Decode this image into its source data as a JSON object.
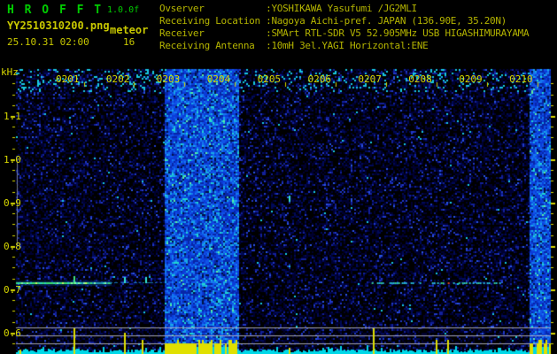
{
  "header": {
    "app_title": "H R O F F T",
    "version": "1.0.0f",
    "filename": "YY2510310200.png",
    "mode": "meteor",
    "datetime": "25.10.31 02:00",
    "meteor_count": "16",
    "info": [
      {
        "label": "Ovserver",
        "value": "YOSHIKAWA Yasufumi /JG2MLI"
      },
      {
        "label": "Receiving Location",
        "value": "Nagoya Aichi-pref. JAPAN (136.90E, 35.20N)"
      },
      {
        "label": "Receiver",
        "value": "SMArt RTL-SDR V5 52.905MHz USB HIGASHIMURAYAMA"
      },
      {
        "label": "Receiving Antenna",
        "value": "10mH 3el.YAGI Horizontal:ENE"
      }
    ]
  },
  "colors": {
    "title_green": "#00cc00",
    "label_yellow": "#c8c800",
    "info_yellow": "#b4b400",
    "tick_yellow": "#d8d800",
    "baseline_cyan": "#00d8e8",
    "bar_yellow": "#e0e000",
    "reference_gray": "#b0b0b8"
  },
  "chart_data": {
    "type": "heatmap",
    "subtype": "radio-meteor-spectrogram",
    "title": "HROFFT 10-minute meteor observation spectrogram 02:00-02:10",
    "x_axis": {
      "start_time": "02:00",
      "end_time": "02:10",
      "span_minutes": 10,
      "tick_labels": [
        "0201",
        "0202",
        "0203",
        "0204",
        "0205",
        "0206",
        "0207",
        "0208",
        "0209",
        "0210"
      ]
    },
    "y_axis": {
      "label": "kHz",
      "tick_labels": [
        "1.1",
        "1.0",
        "0.9",
        "0.8",
        "0.7",
        "0.6"
      ],
      "tick_values": [
        1.1,
        1.0,
        0.9,
        0.8,
        0.7,
        0.6
      ],
      "range_khz": [
        0.575,
        1.19
      ],
      "minor_step_khz": 0.025
    },
    "carrier_line_khz": 0.716,
    "meteor_count": 16,
    "interference_bands": [
      {
        "start_min": 2.75,
        "end_min": 4.14
      },
      {
        "start_min": 9.59,
        "end_min": 10.0
      }
    ],
    "carrier_segments": [
      {
        "start_min": 0.0,
        "end_min": 1.77,
        "style": "strong"
      },
      {
        "start_min": 1.77,
        "end_min": 2.72,
        "style": "faint"
      },
      {
        "start_min": 6.65,
        "end_min": 9.05,
        "style": "dashed-red"
      }
    ],
    "echo_events": [
      {
        "min": 1.08,
        "size": "large"
      },
      {
        "min": 2.02,
        "size": "medium"
      },
      {
        "min": 2.35,
        "size": "small"
      },
      {
        "min": 6.67,
        "size": "large"
      },
      {
        "min": 7.85,
        "size": "small"
      },
      {
        "min": 8.06,
        "size": "small"
      }
    ],
    "echo_spots": [
      {
        "min": 5.1,
        "khz": 0.905
      },
      {
        "min": 2.02,
        "khz": 0.716
      },
      {
        "min": 2.41,
        "khz": 0.717
      }
    ],
    "signal_graph": {
      "baseline_color": "cyan",
      "spike_color": "yellow",
      "reference_lines": 3
    },
    "legend": null,
    "grid": false
  }
}
